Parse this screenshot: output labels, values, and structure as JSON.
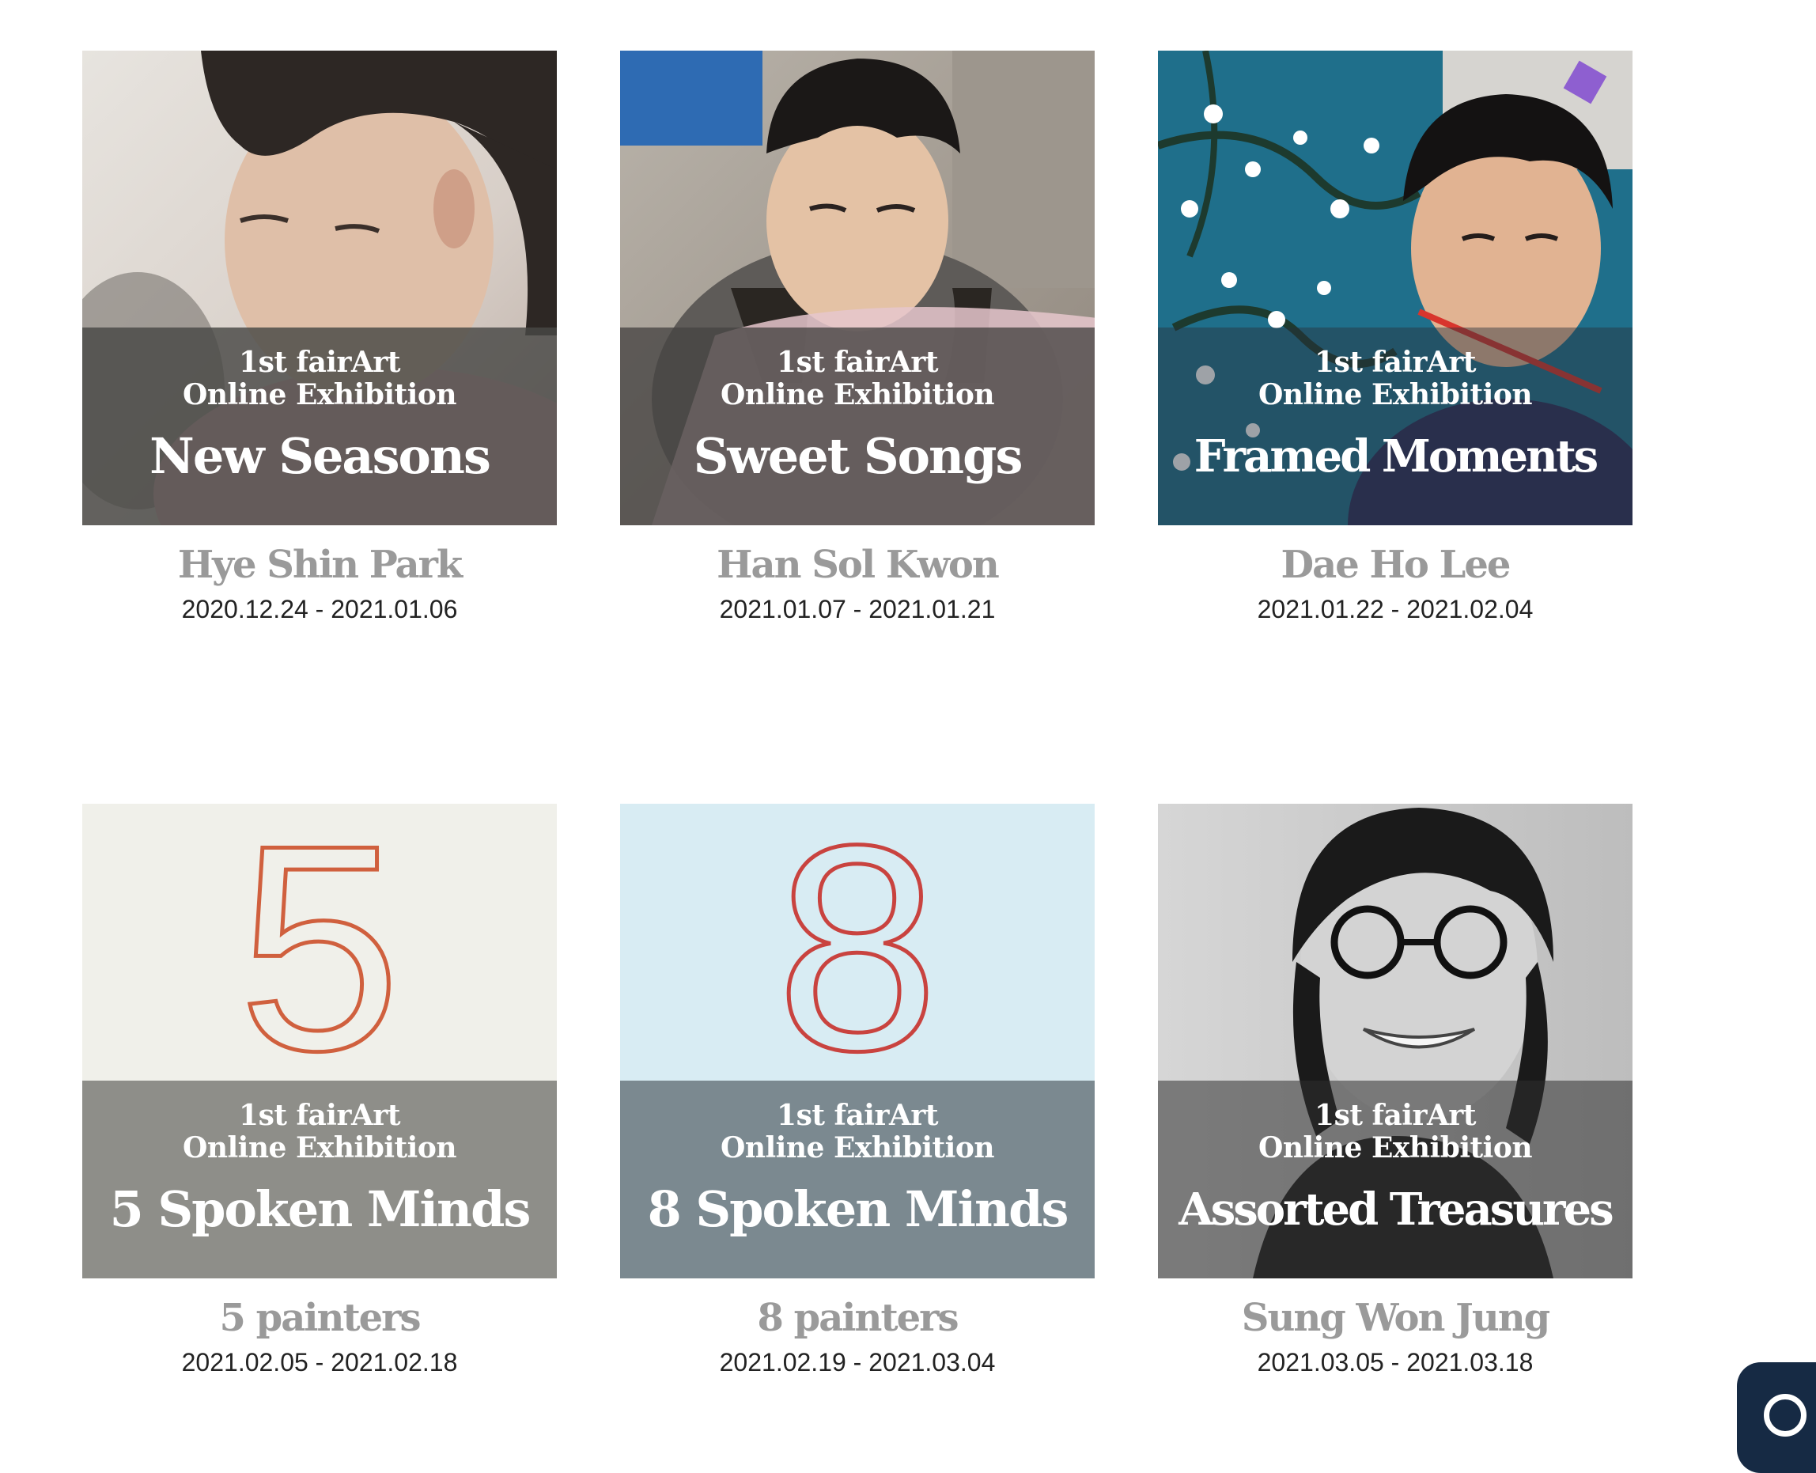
{
  "exhibitions": [
    {
      "line1": "1st fairArt",
      "line2": "Online Exhibition",
      "title": "New Seasons",
      "artist": "Hye Shin Park",
      "dates": "2020.12.24 - 2021.01.06"
    },
    {
      "line1": "1st fairArt",
      "line2": "Online Exhibition",
      "title": "Sweet Songs",
      "artist": "Han Sol Kwon",
      "dates": "2021.01.07 - 2021.01.21"
    },
    {
      "line1": "1st fairArt",
      "line2": "Online Exhibition",
      "title": "Framed Moments",
      "artist": "Dae Ho Lee",
      "dates": "2021.01.22 - 2021.02.04"
    },
    {
      "line1": "1st fairArt",
      "line2": "Online Exhibition",
      "title": "5 Spoken Minds",
      "artist": "5 painters",
      "dates": "2021.02.05 - 2021.02.18",
      "digit": "5"
    },
    {
      "line1": "1st fairArt",
      "line2": "Online Exhibition",
      "title": "8 Spoken Minds",
      "artist": "8 painters",
      "dates": "2021.02.19 - 2021.03.04",
      "digit": "8"
    },
    {
      "line1": "1st fairArt",
      "line2": "Online Exhibition",
      "title": "Assorted Treasures",
      "artist": "Sung Won Jung",
      "dates": "2021.03.05 - 2021.03.18"
    }
  ],
  "colors": {
    "artist_text": "#9a9a9a",
    "date_text": "#222222",
    "digit_orange": "#d0603e",
    "digit_red": "#c9433f",
    "chat_button": "#162a44"
  },
  "icons": {
    "chat": "chat-bubble-icon"
  }
}
